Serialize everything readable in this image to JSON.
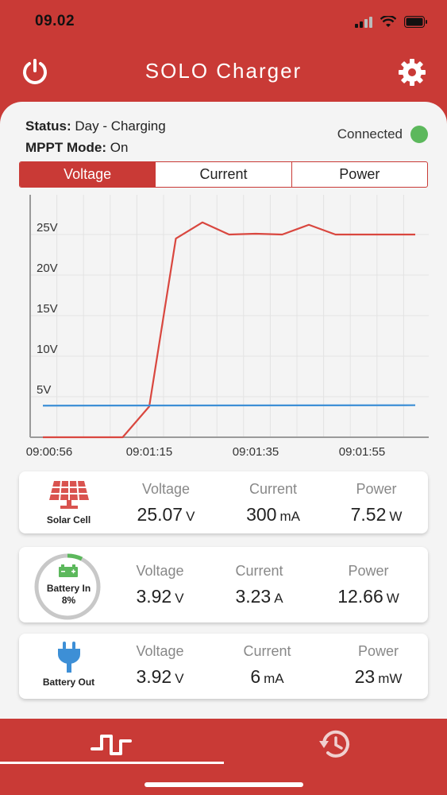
{
  "statusbar": {
    "time": "09.02"
  },
  "header": {
    "title": "SOLO Charger"
  },
  "status": {
    "status_label": "Status:",
    "status_value": "Day - Charging",
    "mppt_label": "MPPT Mode:",
    "mppt_value": "On",
    "connection": "Connected"
  },
  "tabs": [
    "Voltage",
    "Current",
    "Power"
  ],
  "chart_data": {
    "type": "line",
    "x_ticks": [
      "09:00:56",
      "09:01:15",
      "09:01:35",
      "09:01:55"
    ],
    "y_ticks": [
      "5V",
      "10V",
      "15V",
      "20V",
      "25V"
    ],
    "ylim": [
      0,
      27
    ],
    "xlim": [
      0,
      14
    ],
    "series": [
      {
        "color": "#d9473f",
        "x": [
          0,
          3,
          4,
          5,
          6,
          7,
          8,
          9,
          10,
          11,
          12,
          13,
          14
        ],
        "y": [
          0,
          0,
          3.8,
          24.5,
          26.5,
          25,
          25.1,
          25,
          26.2,
          25,
          25,
          25,
          25
        ]
      },
      {
        "color": "#3d8fd6",
        "x": [
          0,
          14
        ],
        "y": [
          3.9,
          3.95
        ]
      }
    ]
  },
  "cards": [
    {
      "label": "Solar Cell",
      "voltage_label": "Voltage",
      "voltage": "25.07",
      "voltage_unit": "V",
      "current_label": "Current",
      "current": "300",
      "current_unit": "mA",
      "power_label": "Power",
      "power": "7.52",
      "power_unit": "W"
    },
    {
      "label": "Battery In",
      "percent": "8%",
      "voltage_label": "Voltage",
      "voltage": "3.92",
      "voltage_unit": "V",
      "current_label": "Current",
      "current": "3.23",
      "current_unit": "A",
      "power_label": "Power",
      "power": "12.66",
      "power_unit": "W"
    },
    {
      "label": "Battery Out",
      "voltage_label": "Voltage",
      "voltage": "3.92",
      "voltage_unit": "V",
      "current_label": "Current",
      "current": "6",
      "current_unit": "mA",
      "power_label": "Power",
      "power": "23",
      "power_unit": "mW"
    }
  ],
  "colors": {
    "brand": "#c93a36",
    "connected": "#5cb85c",
    "voltage_line": "#d9473f",
    "battery_line": "#3d8fd6"
  },
  "icons": [
    "power-icon",
    "gear-icon",
    "solar-panel-icon",
    "battery-icon",
    "plug-icon",
    "waveform-icon",
    "history-icon"
  ]
}
